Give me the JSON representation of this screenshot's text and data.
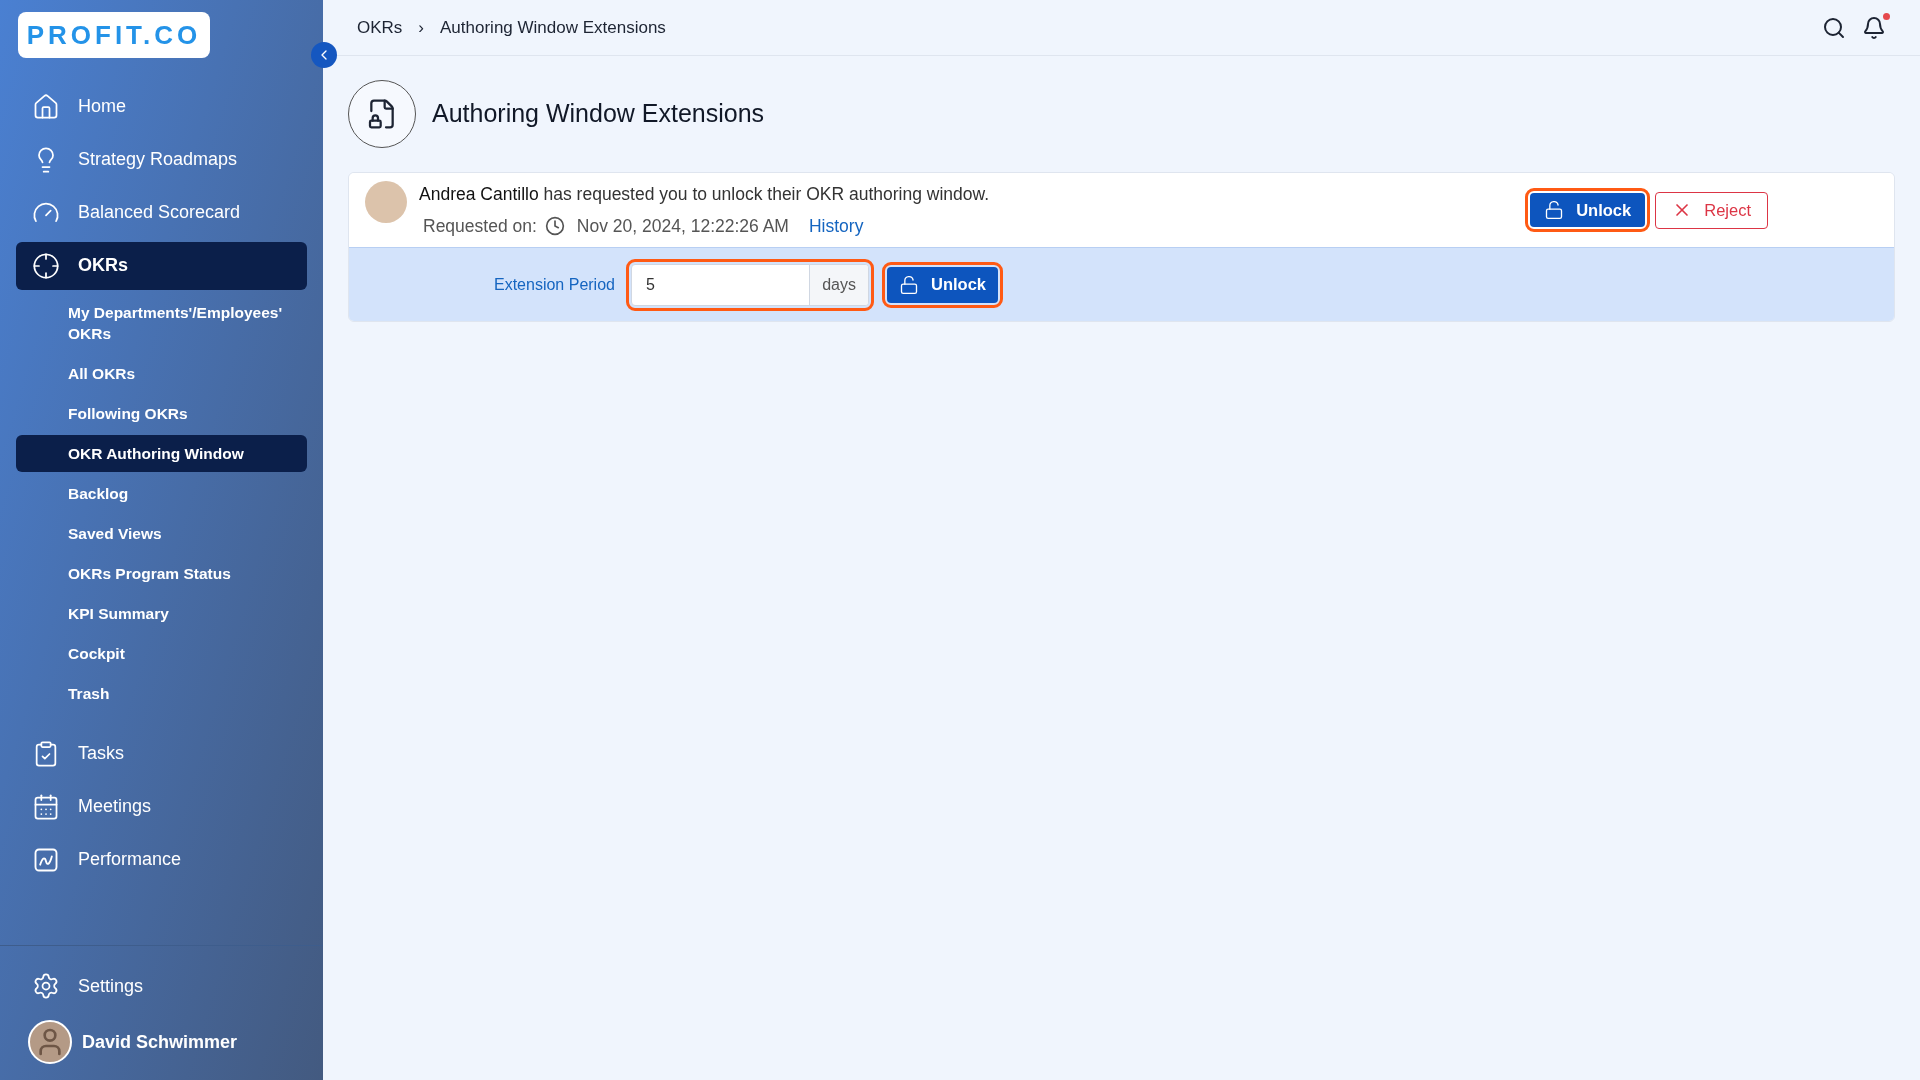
{
  "sidebar": {
    "logo": "PROFIT.CO",
    "items": [
      {
        "kind": "main",
        "label": "Home",
        "selected": false
      },
      {
        "kind": "main",
        "label": "Strategy Roadmaps",
        "selected": false
      },
      {
        "kind": "main",
        "label": "Balanced Scorecard",
        "selected": false
      },
      {
        "kind": "main",
        "label": "OKRs",
        "selected": true
      },
      {
        "kind": "sub",
        "label": "My Departments'/Employees' OKRs",
        "selected": false
      },
      {
        "kind": "sub",
        "label": "All OKRs",
        "selected": false
      },
      {
        "kind": "sub",
        "label": "Following OKRs",
        "selected": false
      },
      {
        "kind": "sub",
        "label": "OKR Authoring Window",
        "selected": true
      },
      {
        "kind": "sub",
        "label": "Backlog",
        "selected": false
      },
      {
        "kind": "sub",
        "label": "Saved Views",
        "selected": false
      },
      {
        "kind": "sub",
        "label": "OKRs Program Status",
        "selected": false
      },
      {
        "kind": "sub",
        "label": "KPI Summary",
        "selected": false
      },
      {
        "kind": "sub",
        "label": "Cockpit",
        "selected": false
      },
      {
        "kind": "sub",
        "label": "Trash",
        "selected": false
      },
      {
        "kind": "gap"
      },
      {
        "kind": "main",
        "label": "Tasks",
        "selected": false
      },
      {
        "kind": "main",
        "label": "Meetings",
        "selected": false
      },
      {
        "kind": "main",
        "label": "Performance",
        "selected": false
      }
    ],
    "settings": "Settings",
    "user": "David Schwimmer"
  },
  "breadcrumbs": [
    "OKRs",
    "Authoring Window Extensions"
  ],
  "breadcrumb_separator": "›",
  "notifications": {
    "unread": true
  },
  "page": {
    "title": "Authoring Window Extensions"
  },
  "request": {
    "name": "Andrea Cantillo",
    "message": "has requested you to unlock their OKR authoring window.",
    "requested_label": "Requested on:",
    "requested_at": "Nov 20, 2024, 12:22:26 AM",
    "history_link": "History",
    "unlock_button": {
      "label": "Unlock",
      "highlighted": true
    },
    "reject_button": {
      "label": "Reject",
      "highlighted": false
    }
  },
  "extension": {
    "label": "Extension Period",
    "value": "5",
    "unit": "days",
    "field_highlighted": true,
    "unlock_button": {
      "label": "Unlock",
      "highlighted": true
    }
  }
}
